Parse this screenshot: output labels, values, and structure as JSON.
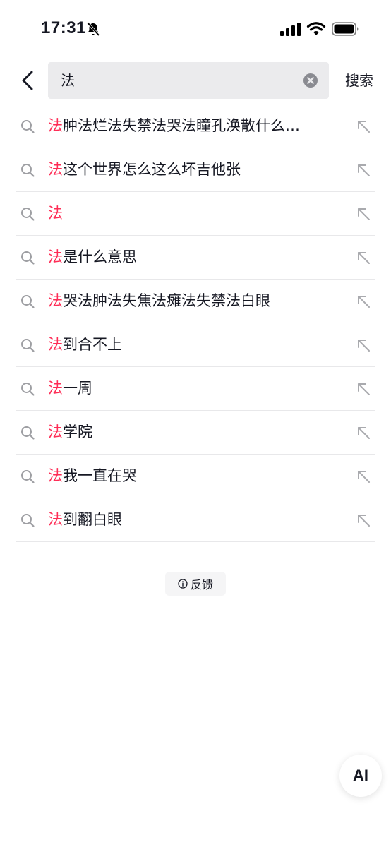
{
  "status_bar": {
    "time": "17:31",
    "icons": [
      "bell-slash-icon",
      "signal-icon",
      "wifi-icon",
      "battery-icon"
    ]
  },
  "search": {
    "value": "法",
    "submit_label": "搜索"
  },
  "suggestions": [
    {
      "highlight": "法",
      "rest": "肿法烂法失禁法哭法瞳孔涣散什么…"
    },
    {
      "highlight": "法",
      "rest": "这个世界怎么这么坏吉他张"
    },
    {
      "highlight": "法",
      "rest": ""
    },
    {
      "highlight": "法",
      "rest": "是什么意思"
    },
    {
      "highlight": "法",
      "rest": "哭法肿法失焦法瘫法失禁法白眼"
    },
    {
      "highlight": "法",
      "rest": "到合不上"
    },
    {
      "highlight": "法",
      "rest": "一周"
    },
    {
      "highlight": "法",
      "rest": "学院"
    },
    {
      "highlight": "法",
      "rest": "我一直在哭"
    },
    {
      "highlight": "法",
      "rest": "到翻白眼"
    }
  ],
  "feedback_label": "反馈",
  "ai_label": "AI",
  "colors": {
    "highlight": "#fe2c55",
    "text": "#161823",
    "search_bg": "#ebebed",
    "divider": "#e8e8ea"
  }
}
